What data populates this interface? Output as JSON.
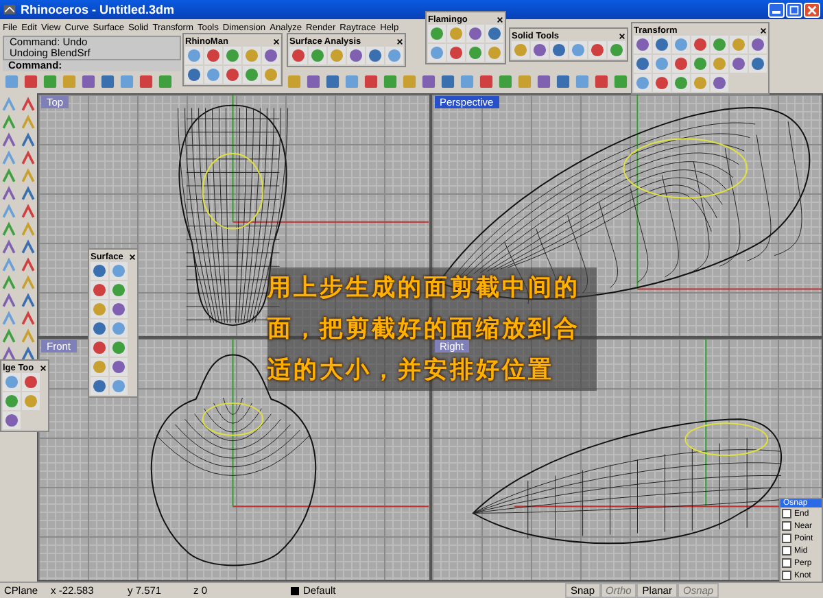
{
  "window": {
    "title": "Rhinoceros - Untitled.3dm"
  },
  "menu": [
    "File",
    "Edit",
    "View",
    "Curve",
    "Surface",
    "Solid",
    "Transform",
    "Tools",
    "Dimension",
    "Analyze",
    "Render",
    "Raytrace",
    "Help"
  ],
  "command_history": [
    "Command: Undo",
    "Undoing BlendSrf"
  ],
  "command_prompt": "Command:",
  "viewports": [
    {
      "label": "Top",
      "selected": false
    },
    {
      "label": "Perspective",
      "selected": true
    },
    {
      "label": "Front",
      "selected": false
    },
    {
      "label": "Right",
      "selected": false
    }
  ],
  "floating_toolbars": [
    {
      "title": "RhinoMan"
    },
    {
      "title": "Surface Analysis"
    },
    {
      "title": "Flamingo"
    },
    {
      "title": "Solid Tools"
    },
    {
      "title": "Transform"
    },
    {
      "title": "Surface"
    },
    {
      "title": "lge Too"
    }
  ],
  "annotation": "用上步生成的面剪截中间的面，把剪截好的面缩放到合适的大小，并安排好位置",
  "osnap": {
    "title": "Osnap",
    "items": [
      {
        "label": "End",
        "checked": false
      },
      {
        "label": "Near",
        "checked": false
      },
      {
        "label": "Point",
        "checked": false
      },
      {
        "label": "Mid",
        "checked": false
      },
      {
        "label": "Perp",
        "checked": false
      },
      {
        "label": "Knot",
        "checked": false
      }
    ]
  },
  "status_bar": {
    "cplane": "CPlane",
    "x": "x -22.583",
    "y": "y 7.571",
    "z": "z 0",
    "layer": "Default",
    "toggles": [
      {
        "label": "Snap",
        "on": true
      },
      {
        "label": "Ortho",
        "on": false
      },
      {
        "label": "Planar",
        "on": true
      },
      {
        "label": "Osnap",
        "on": false
      }
    ]
  }
}
